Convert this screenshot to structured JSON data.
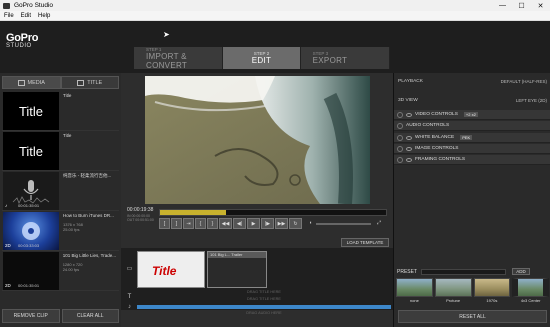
{
  "window": {
    "title": "GoPro Studio",
    "minimize": "—",
    "maximize": "☐",
    "close": "✕"
  },
  "menu": [
    "File",
    "Edit",
    "Help"
  ],
  "logo": {
    "brand": "GoPro",
    "product": "STUDIO"
  },
  "steps": [
    {
      "num": "STEP 1",
      "label": "IMPORT & CONVERT"
    },
    {
      "num": "STEP 2",
      "label": "EDIT"
    },
    {
      "num": "STEP 3",
      "label": "EXPORT"
    }
  ],
  "library": {
    "tabs": [
      "MEDIA",
      "TITLE"
    ],
    "clips": [
      {
        "name": "Title",
        "thumb_text": "Title",
        "info": "",
        "duration": "",
        "badge": ""
      },
      {
        "name": "Title",
        "thumb_text": "Title",
        "info": "",
        "duration": "",
        "badge": ""
      },
      {
        "name": "纯音乐 - 轻柔流行吉他...",
        "thumb_text": "",
        "info": "",
        "duration": "00:01:35:01",
        "badge": "♪"
      },
      {
        "name": "How to Burn iTunes DR...",
        "thumb_text": "",
        "info": "1376 x 768\n25.00 fps",
        "duration": "00:03:33:03",
        "badge": "2D"
      },
      {
        "name": "101 Big Little Lies, Trade...",
        "thumb_text": "",
        "info": "1280 x 720\n24.00 fps",
        "duration": "00:01:35:01",
        "badge": "2D"
      }
    ],
    "remove_label": "REMOVE CLIP",
    "clear_label": "CLEAR ALL"
  },
  "player": {
    "timecode": "00:00:19:38",
    "in": "IN  00:00:00:00",
    "out": "OUT 00:00:51:00",
    "load_template": "LOAD TEMPLATE",
    "progress": 0.29
  },
  "timeline": {
    "clip1_text": "Title",
    "clip2_label": "101 Big L... Trailer",
    "drag_title": "DRAG TITLE HERE",
    "drag_title2": "DRAG TITLE HERE",
    "drag_audio": "DRAG AUDIO HERE"
  },
  "right": {
    "playback_label": "PLAYBACK",
    "playback_value": "DEFAULT (HALF-RES)",
    "view_label": "3D VIEW",
    "view_value": "LEFT EYE (2D)",
    "sections": [
      {
        "label": "VIDEO CONTROLS",
        "value": "+2  x2"
      },
      {
        "label": "AUDIO CONTROLS",
        "value": ""
      },
      {
        "label": "WHITE BALANCE",
        "value": "PEK"
      },
      {
        "label": "IMAGE CONTROLS",
        "value": ""
      },
      {
        "label": "FRAMING CONTROLS",
        "value": ""
      }
    ],
    "preset_label": "PRESET",
    "add_label": "ADD",
    "presets": [
      "none",
      "Protune",
      "1970s",
      "4x3 Center"
    ],
    "reset_label": "RESET ALL"
  },
  "colors": {
    "accent": "#c8b22e",
    "audio": "#3d87c9",
    "active_step": "#6b6b6b"
  }
}
